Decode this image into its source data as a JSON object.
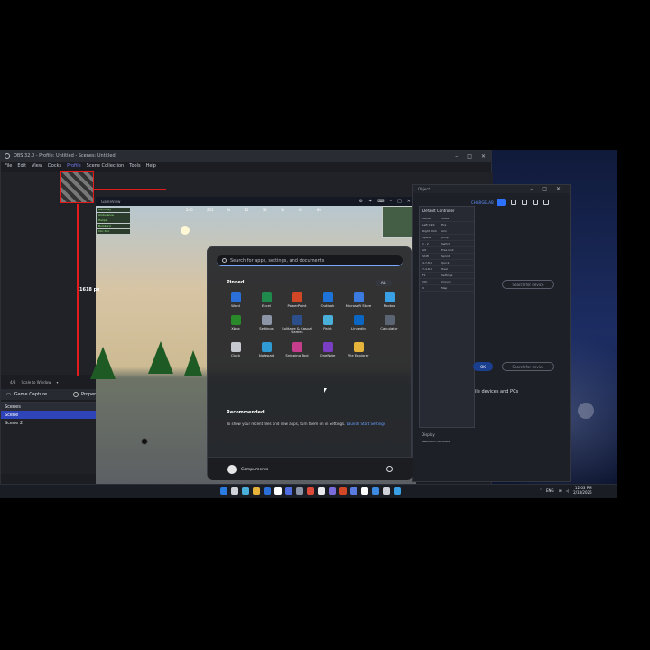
{
  "obs": {
    "title": "OBS 32.0 - Profile: Untitled - Scenes: Untitled",
    "menu": [
      "File",
      "Edit",
      "View",
      "Docks",
      "Profile",
      "Scene Collection",
      "Tools",
      "Help"
    ],
    "dimension_label": "1618 px",
    "source_toolbar": [
      "4/8",
      "Scale to Window"
    ],
    "selected_source": "Game Capture",
    "properties_label": "Properties",
    "scenes_header": "Scenes",
    "scenes": [
      "Scene",
      "Scene 2"
    ]
  },
  "game": {
    "window_title": "GameView",
    "compass": [
      "240",
      "255",
      "N",
      "15",
      "30",
      "W",
      "45",
      "60"
    ],
    "hud": [
      "Dennisay",
      "Ambulance",
      "Helipal",
      "Bombard",
      "Cbc Doc"
    ]
  },
  "settings_window": {
    "title": "Object",
    "controller_header": "Default Controller",
    "controller_rows": [
      [
        "WASD",
        "Move"
      ],
      [
        "Left Click",
        "Fire"
      ],
      [
        "Right Click",
        "Aim"
      ],
      [
        "Space",
        "Jump"
      ],
      [
        "1 - 2",
        "Switch"
      ],
      [
        "Alt",
        "Free look"
      ],
      [
        "Shift",
        "Sprint"
      ],
      [
        "4-7-8-9",
        "Quick"
      ],
      [
        "7-4-8-9",
        "Heal"
      ],
      [
        "F1",
        "Settings"
      ],
      [
        "Ctrl",
        "Crouch"
      ],
      [
        "X",
        "Map"
      ]
    ],
    "display_label": "Display",
    "resolution_label": "Resolution HD 1080P",
    "search_device_1": "Search for device",
    "search_device_2": "Search for device",
    "ok_label": "OK",
    "devices_text": "ile devices and PCs",
    "account_label": "CHARGELAB"
  },
  "start_menu": {
    "search_placeholder": "Search for apps, settings, and documents",
    "pinned_label": "Pinned",
    "all_label": "All",
    "pinned_apps": [
      {
        "name": "Word",
        "color": "#2b6fd8"
      },
      {
        "name": "Excel",
        "color": "#1f8a4c"
      },
      {
        "name": "PowerPoint",
        "color": "#d24726"
      },
      {
        "name": "Outlook",
        "color": "#1e73d9"
      },
      {
        "name": "Microsoft Store",
        "color": "#3b7be0"
      },
      {
        "name": "Photos",
        "color": "#3aa0e6"
      },
      {
        "name": "Xbox",
        "color": "#2a8a2a"
      },
      {
        "name": "Settings",
        "color": "#8b95a5"
      },
      {
        "name": "Solitaire & Casual Games",
        "color": "#2c4f8c"
      },
      {
        "name": "Paint",
        "color": "#4ab0d9"
      },
      {
        "name": "LinkedIn",
        "color": "#0a66c2"
      },
      {
        "name": "Calculator",
        "color": "#5b6472"
      },
      {
        "name": "Clock",
        "color": "#c6c9cf"
      },
      {
        "name": "Notepad",
        "color": "#2f9bd2"
      },
      {
        "name": "Snipping Tool",
        "color": "#c53d8c"
      },
      {
        "name": "OneNote",
        "color": "#7a3ec2"
      },
      {
        "name": "File Explorer",
        "color": "#e6b43a"
      }
    ],
    "recommended_label": "Recommended",
    "recommended_text": "To show your recent files and new apps, turn them on in Settings.",
    "recommended_link": "Launch Start Settings",
    "user_name": "Compuments"
  },
  "taskbar": {
    "icon_colors": [
      "#2b7be0",
      "#cfd2d8",
      "#4ab0d9",
      "#e6b43a",
      "#2b6fd8",
      "#ffffff",
      "#4f6be0",
      "#8c96a8",
      "#de4a3a",
      "#e8eaee",
      "#7b6cdb",
      "#d24726",
      "#5a7be0",
      "#ffffff",
      "#3c8be0",
      "#cfd2d8",
      "#3aa0e6"
    ],
    "language": "ENG",
    "time": "12:03 PM",
    "date": "2/18/2026"
  }
}
